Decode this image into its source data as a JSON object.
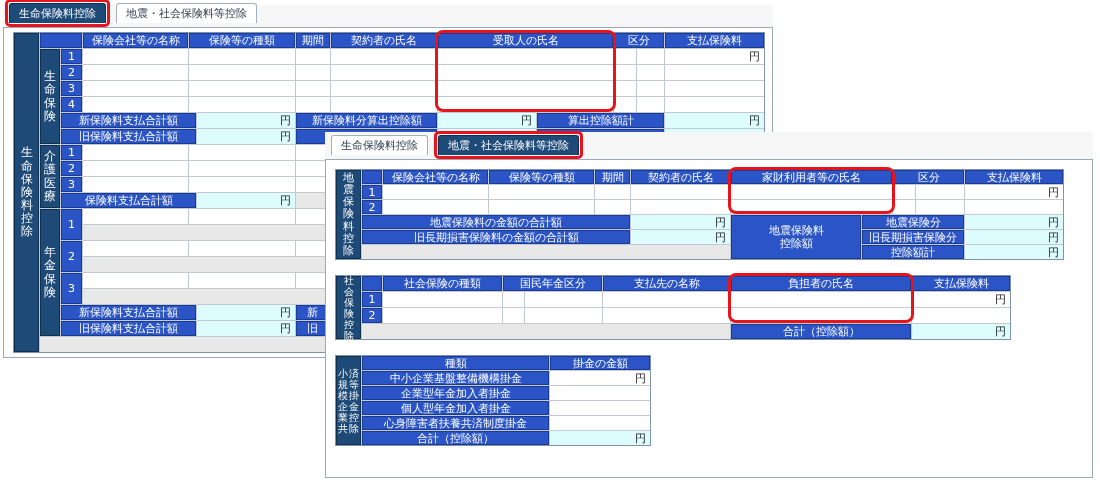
{
  "left_window": {
    "tabs": [
      {
        "label": "生命保険料控除",
        "selected": true,
        "highlighted": true
      },
      {
        "label": "地震・社会保険料等控除",
        "selected": false,
        "highlighted": false
      }
    ],
    "section_label": "生命保険料控除",
    "columns": [
      {
        "label": "保険会社等の名称",
        "highlighted": false
      },
      {
        "label": "保険等の種類",
        "highlighted": false
      },
      {
        "label": "期間",
        "highlighted": false
      },
      {
        "label": "契約者の氏名",
        "highlighted": false
      },
      {
        "label": "受取人の氏名",
        "highlighted": true
      },
      {
        "label": "区分",
        "highlighted": false
      },
      {
        "label": "支払保険料",
        "highlighted": false
      }
    ],
    "life_insurance": {
      "label": "生命保険",
      "rows": [
        {
          "number": "1",
          "premium": "円"
        },
        {
          "number": "2"
        },
        {
          "number": "3"
        },
        {
          "number": "4"
        }
      ],
      "totals": [
        {
          "label": "新保険料支払合計額",
          "amount": "円",
          "deduction_label": "新保険料分算出控除額",
          "deduction_amount": "円",
          "sum_label": "算出控除額計",
          "sum_amount": "円"
        },
        {
          "label": "旧保険料支払合計額",
          "amount": "円"
        }
      ]
    },
    "care_medical": {
      "label": "介護医療",
      "rows": [
        {
          "number": "1"
        },
        {
          "number": "2"
        },
        {
          "number": "3"
        }
      ],
      "total_label": "保険料支払合計額",
      "total_amount": "円"
    },
    "pension": {
      "label": "年金保険",
      "rows": [
        {
          "number": "1"
        },
        {
          "number": "2"
        },
        {
          "number": "3"
        }
      ],
      "totals": [
        {
          "label": "新保険料支払合計額",
          "amount": "円",
          "deduction_label": "新"
        },
        {
          "label": "旧保険料支払合計額",
          "amount": "円",
          "deduction_label": "旧"
        }
      ]
    }
  },
  "right_window": {
    "tabs": [
      {
        "label": "生命保険料控除",
        "selected": false,
        "highlighted": false
      },
      {
        "label": "地震・社会保険料等控除",
        "selected": true,
        "highlighted": true
      }
    ],
    "earthquake": {
      "section_label": "地震保険料控除",
      "columns": [
        {
          "label": "保険会社等の名称",
          "highlighted": false
        },
        {
          "label": "保険等の種類",
          "highlighted": false
        },
        {
          "label": "期間",
          "highlighted": false
        },
        {
          "label": "契約者の氏名",
          "highlighted": false
        },
        {
          "label": "家財利用者等の氏名",
          "highlighted": true
        },
        {
          "label": "区分",
          "highlighted": false
        },
        {
          "label": "支払保険料",
          "highlighted": false
        }
      ],
      "rows": [
        {
          "number": "1",
          "premium": "円"
        },
        {
          "number": "2"
        }
      ],
      "totals": [
        {
          "label": "地震保険料の金額の合計額",
          "amount": "円"
        },
        {
          "label": "旧長期損害保険料の金額の合計額",
          "amount": "円"
        }
      ],
      "deduction_label": "地震保険料控除額",
      "deductions": [
        {
          "label": "地震保険分",
          "amount": "円"
        },
        {
          "label": "旧長期損害保険分",
          "amount": "円"
        },
        {
          "label": "控除額計",
          "amount": "円"
        }
      ]
    },
    "social": {
      "section_label": "社会保険控除",
      "columns": [
        {
          "label": "社会保険の種類",
          "highlighted": false
        },
        {
          "label": "国民年金区分",
          "highlighted": false
        },
        {
          "label": "支払先の名称",
          "highlighted": false
        },
        {
          "label": "負担者の氏名",
          "highlighted": true
        },
        {
          "label": "支払保険料",
          "highlighted": false
        }
      ],
      "rows": [
        {
          "number": "1",
          "premium": "円"
        },
        {
          "number": "2"
        }
      ],
      "total_label": "合計（控除額）",
      "total_amount": "円"
    },
    "small_business": {
      "section_label_columns": [
        "小規模企業共",
        "済等掛金控除"
      ],
      "columns": [
        {
          "label": "種類"
        },
        {
          "label": "掛金の金額"
        }
      ],
      "rows": [
        {
          "kind": "item",
          "label": "中小企業基盤整備機構掛金",
          "amount": "円"
        },
        {
          "kind": "item",
          "label": "企業型年金加入者掛金"
        },
        {
          "kind": "item",
          "label": "個人型年金加入者掛金"
        },
        {
          "kind": "item",
          "label": "心身障害者扶養共済制度掛金"
        },
        {
          "kind": "total",
          "label": "合計（控除額）",
          "amount": "円"
        }
      ]
    }
  }
}
